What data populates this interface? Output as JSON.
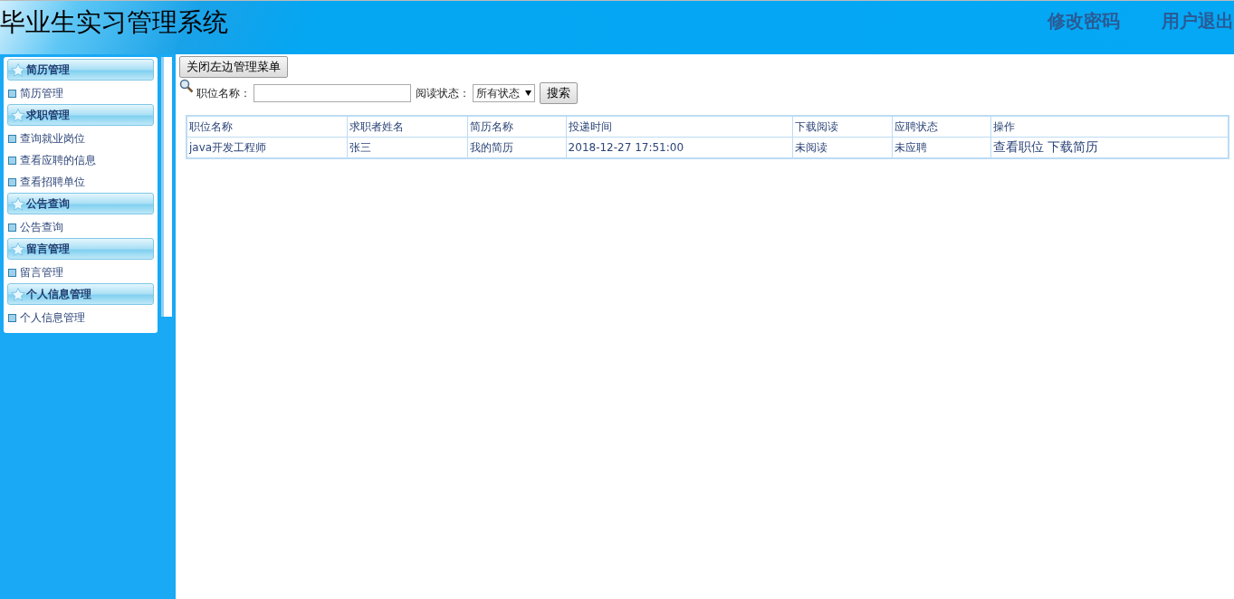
{
  "header": {
    "title": "毕业生实习管理系统",
    "links": [
      "修改密码",
      "用户退出"
    ]
  },
  "sidebar": {
    "groups": [
      {
        "title": "简历管理",
        "items": [
          "简历管理"
        ]
      },
      {
        "title": "求职管理",
        "items": [
          "查询就业岗位",
          "查看应聘的信息",
          "查看招聘单位"
        ]
      },
      {
        "title": "公告查询",
        "items": [
          "公告查询"
        ]
      },
      {
        "title": "留言管理",
        "items": [
          "留言管理"
        ]
      },
      {
        "title": "个人信息管理",
        "items": [
          "个人信息管理"
        ]
      }
    ]
  },
  "toggle_button": "关闭左边管理菜单",
  "search": {
    "label": "职位名称：",
    "status_label": "阅读状态：",
    "status_value": "所有状态",
    "button": "搜索"
  },
  "table": {
    "columns": [
      "职位名称",
      "求职者姓名",
      "简历名称",
      "投递时间",
      "下载阅读",
      "应聘状态",
      "操作"
    ],
    "rows": [
      {
        "cells": [
          "java开发工程师",
          "张三",
          "我的简历",
          "2018-12-27 17:51:00",
          "未阅读",
          "未应聘"
        ],
        "actions": [
          "查看职位",
          "下载简历"
        ]
      }
    ]
  }
}
